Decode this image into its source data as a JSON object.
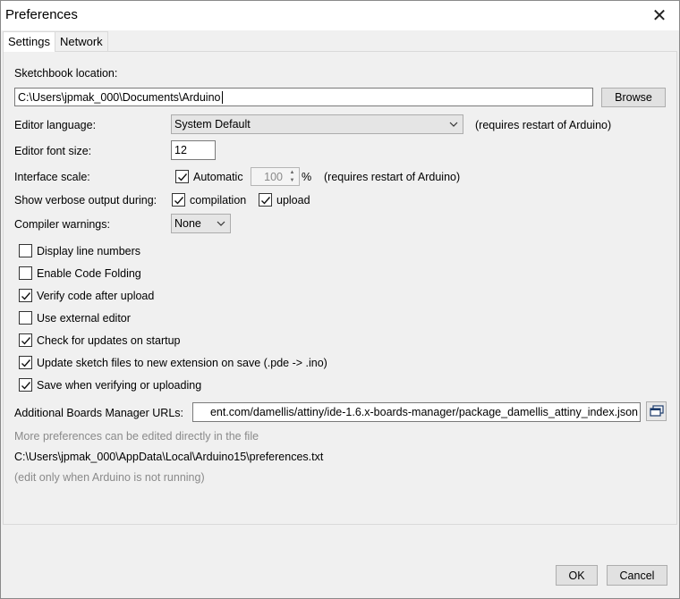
{
  "window": {
    "title": "Preferences",
    "close_glyph": "✕"
  },
  "tabs": [
    {
      "label": "Settings",
      "active": true
    },
    {
      "label": "Network",
      "active": false
    }
  ],
  "settings": {
    "sketchbook_location_label": "Sketchbook location:",
    "sketchbook_path": "C:\\Users\\jpmak_000\\Documents\\Arduino",
    "browse_label": "Browse",
    "editor_language_label": "Editor language:",
    "editor_language_value": "System Default",
    "editor_language_note": "(requires restart of Arduino)",
    "editor_font_size_label": "Editor font size:",
    "editor_font_size_value": "12",
    "interface_scale_label": "Interface scale:",
    "interface_scale_automatic_label": "Automatic",
    "interface_scale_automatic_checked": true,
    "interface_scale_value": "100",
    "interface_scale_unit": "%",
    "interface_scale_note": "(requires restart of Arduino)",
    "verbose_label": "Show verbose output during:",
    "verbose_compilation_label": "compilation",
    "verbose_compilation_checked": true,
    "verbose_upload_label": "upload",
    "verbose_upload_checked": true,
    "compiler_warnings_label": "Compiler warnings:",
    "compiler_warnings_value": "None",
    "options": [
      {
        "label": "Display line numbers",
        "checked": false
      },
      {
        "label": "Enable Code Folding",
        "checked": false
      },
      {
        "label": "Verify code after upload",
        "checked": true
      },
      {
        "label": "Use external editor",
        "checked": false
      },
      {
        "label": "Check for updates on startup",
        "checked": true
      },
      {
        "label": "Update sketch files to new extension on save (.pde -> .ino)",
        "checked": true
      },
      {
        "label": "Save when verifying or uploading",
        "checked": true
      }
    ],
    "boards_urls_label": "Additional Boards Manager URLs:",
    "boards_urls_value": "ent.com/damellis/attiny/ide-1.6.x-boards-manager/package_damellis_attiny_index.json",
    "more_prefs_note": "More preferences can be edited directly in the file",
    "prefs_file_path": "C:\\Users\\jpmak_000\\AppData\\Local\\Arduino15\\preferences.txt",
    "edit_note": "(edit only when Arduino is not running)"
  },
  "footer": {
    "ok_label": "OK",
    "cancel_label": "Cancel"
  }
}
